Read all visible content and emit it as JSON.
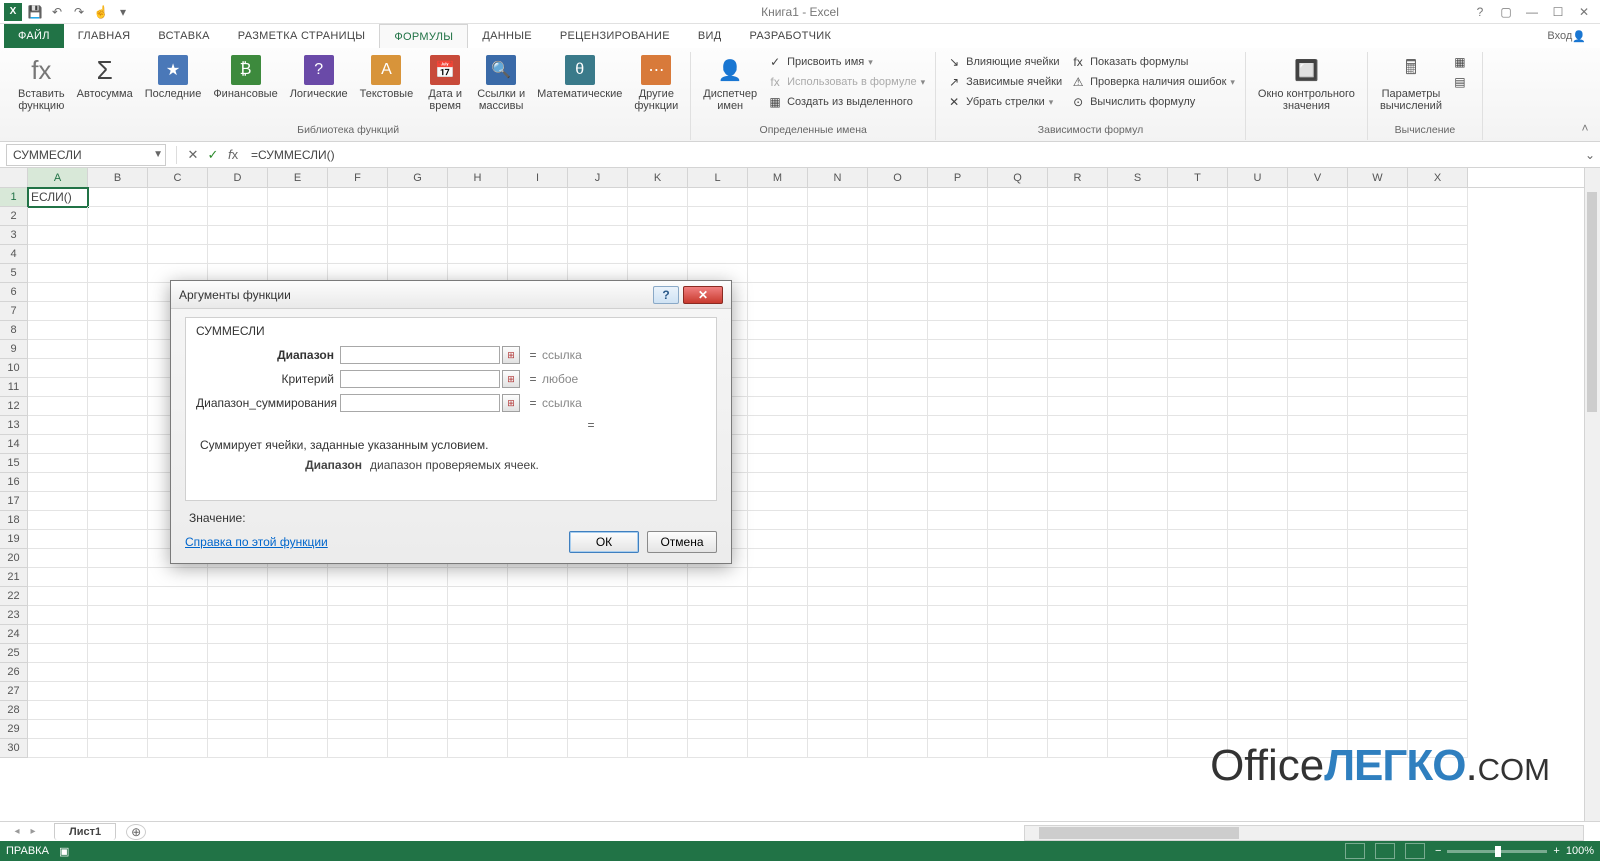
{
  "title": "Книга1 - Excel",
  "login": "Вход",
  "qat_icons": [
    "save-icon",
    "undo-icon",
    "redo-icon",
    "touch-icon",
    "customize-icon"
  ],
  "tabs": [
    "ФАЙЛ",
    "ГЛАВНАЯ",
    "ВСТАВКА",
    "РАЗМЕТКА СТРАНИЦЫ",
    "ФОРМУЛЫ",
    "ДАННЫЕ",
    "РЕЦЕНЗИРОВАНИЕ",
    "ВИД",
    "РАЗРАБОТЧИК"
  ],
  "active_tab": 4,
  "ribbon": {
    "groups": [
      {
        "label": "Библиотека функций",
        "items": [
          {
            "kind": "big",
            "icon": "fx",
            "label": "Вставить\nфункцию",
            "color": "#777"
          },
          {
            "kind": "big",
            "icon": "Σ",
            "label": "Автосумма",
            "color": "#444"
          },
          {
            "kind": "big",
            "icon": "★",
            "label": "Последние",
            "color": "#4a78b8",
            "bg": "#4a78b8"
          },
          {
            "kind": "big",
            "icon": "₿",
            "label": "Финансовые",
            "color": "#3d8a3d",
            "bg": "#3d8a3d"
          },
          {
            "kind": "big",
            "icon": "?",
            "label": "Логические",
            "color": "#6a4aa8",
            "bg": "#6a4aa8"
          },
          {
            "kind": "big",
            "icon": "A",
            "label": "Текстовые",
            "color": "#d8943a",
            "bg": "#d8943a"
          },
          {
            "kind": "big",
            "icon": "📅",
            "label": "Дата и\nвремя",
            "color": "#c84a3a",
            "bg": "#c84a3a"
          },
          {
            "kind": "big",
            "icon": "🔍",
            "label": "Ссылки и\nмассивы",
            "color": "#3a6aa8",
            "bg": "#3a6aa8"
          },
          {
            "kind": "big",
            "icon": "θ",
            "label": "Математические",
            "color": "#3a7a8a",
            "bg": "#3a7a8a"
          },
          {
            "kind": "big",
            "icon": "⋯",
            "label": "Другие\nфункции",
            "color": "#d87a3a",
            "bg": "#d87a3a"
          }
        ]
      },
      {
        "label": "Определенные имена",
        "items": [
          {
            "kind": "big",
            "icon": "👤",
            "label": "Диспетчер\nимен",
            "color": "#666"
          },
          {
            "kind": "stack",
            "rows": [
              {
                "icon": "✓",
                "label": "Присвоить имя",
                "dd": true
              },
              {
                "icon": "fx",
                "label": "Использовать в формуле",
                "dd": true,
                "dim": true
              },
              {
                "icon": "▦",
                "label": "Создать из выделенного"
              }
            ]
          }
        ]
      },
      {
        "label": "Зависимости формул",
        "items": [
          {
            "kind": "stack",
            "rows": [
              {
                "icon": "↘",
                "label": "Влияющие ячейки"
              },
              {
                "icon": "↗",
                "label": "Зависимые ячейки"
              },
              {
                "icon": "✕",
                "label": "Убрать стрелки",
                "dd": true
              }
            ]
          },
          {
            "kind": "stack",
            "rows": [
              {
                "icon": "fx",
                "label": "Показать формулы"
              },
              {
                "icon": "⚠",
                "label": "Проверка наличия ошибок",
                "dd": true
              },
              {
                "icon": "⊙",
                "label": "Вычислить формулу"
              }
            ]
          }
        ]
      },
      {
        "label": "",
        "items": [
          {
            "kind": "big",
            "icon": "🔲",
            "label": "Окно контрольного\nзначения",
            "color": "#666"
          }
        ]
      },
      {
        "label": "Вычисление",
        "items": [
          {
            "kind": "big",
            "icon": "🖩",
            "label": "Параметры\nвычислений",
            "color": "#666"
          },
          {
            "kind": "stack",
            "rows": [
              {
                "icon": "▦",
                "label": ""
              },
              {
                "icon": "▤",
                "label": ""
              }
            ]
          }
        ]
      }
    ]
  },
  "namebox": "СУММЕСЛИ",
  "formula": "=СУММЕСЛИ()",
  "columns": [
    "A",
    "B",
    "C",
    "D",
    "E",
    "F",
    "G",
    "H",
    "I",
    "J",
    "K",
    "L",
    "M",
    "N",
    "O",
    "P",
    "Q",
    "R",
    "S",
    "T",
    "U",
    "V",
    "W",
    "X"
  ],
  "rows_count": 30,
  "active_cell": {
    "row": 1,
    "col": 0,
    "value": "ЕСЛИ()"
  },
  "sheet": "Лист1",
  "status_mode": "ПРАВКА",
  "zoom": "100%",
  "dialog": {
    "title": "Аргументы функции",
    "func": "СУММЕСЛИ",
    "args": [
      {
        "label": "Диапазон",
        "bold": true,
        "value": "",
        "result": "ссылка"
      },
      {
        "label": "Критерий",
        "bold": false,
        "value": "",
        "result": "любое"
      },
      {
        "label": "Диапазон_суммирования",
        "bold": false,
        "value": "",
        "result": "ссылка"
      }
    ],
    "eq": "=",
    "desc": "Суммирует ячейки, заданные указанным условием.",
    "arg_desc_key": "Диапазон",
    "arg_desc_val": "диапазон проверяемых ячеек.",
    "value_label": "Значение:",
    "help_link": "Справка по этой функции",
    "ok": "ОК",
    "cancel": "Отмена"
  },
  "watermark": {
    "a": "Office",
    "b": "ЛЕГКО",
    "c": ".com"
  }
}
